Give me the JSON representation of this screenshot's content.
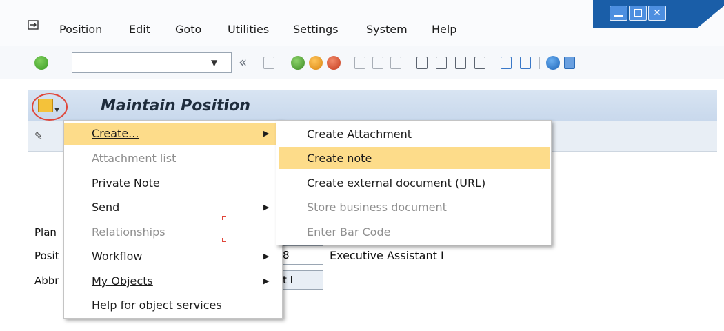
{
  "menubar": {
    "items": [
      "Position",
      "Edit",
      "Goto",
      "Utilities",
      "Settings",
      "System",
      "Help"
    ]
  },
  "toolbar": {
    "command_value": ""
  },
  "screen": {
    "title": "Maintain Position"
  },
  "fields": {
    "plan_label": "Plan",
    "position_label": "Posit",
    "abbr_label": "Abbr",
    "position_value": "8",
    "position_description": "Executive Assistant I",
    "abbr_value": "t I"
  },
  "context_menu": {
    "items": [
      {
        "label": "Create...",
        "enabled": true,
        "submenu": true,
        "highlighted": true
      },
      {
        "label": "Attachment list",
        "enabled": false,
        "submenu": false
      },
      {
        "label": "Private Note",
        "enabled": true,
        "submenu": false
      },
      {
        "label": "Send",
        "enabled": true,
        "submenu": true
      },
      {
        "label": "Relationships",
        "enabled": false,
        "submenu": false
      },
      {
        "label": "Workflow",
        "enabled": true,
        "submenu": true
      },
      {
        "label": "My Objects",
        "enabled": true,
        "submenu": true
      },
      {
        "label": "Help for object services",
        "enabled": true,
        "submenu": false
      }
    ]
  },
  "submenu": {
    "items": [
      {
        "label": "Create Attachment",
        "enabled": true
      },
      {
        "label": "Create note",
        "enabled": true,
        "highlighted": true
      },
      {
        "label": "Create external document (URL)",
        "enabled": true
      },
      {
        "label": "Store business document",
        "enabled": false
      },
      {
        "label": "Enter Bar Code",
        "enabled": false
      }
    ]
  },
  "colors": {
    "highlight": "#fddc8a",
    "header": "#d8e4f2",
    "window_frame": "#1a5ea8",
    "annotation": "#e0463a"
  }
}
